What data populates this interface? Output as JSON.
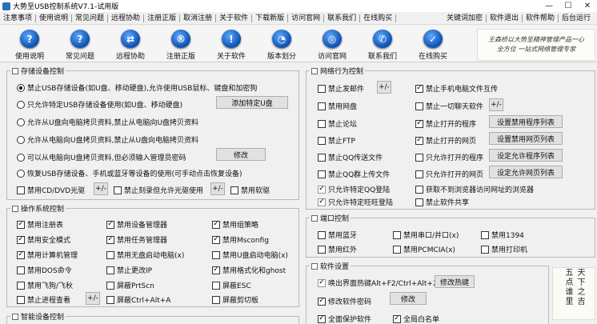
{
  "window": {
    "title": "大势至USB控制系统V7.1-试用版",
    "minimize": "—",
    "maximize": "☐",
    "close": "✕"
  },
  "menu": {
    "left": [
      "注意事项",
      "使用说明",
      "常见问题",
      "远程协助",
      "注册正版",
      "取消注册",
      "关于软件",
      "下载新版",
      "访问官网",
      "联系我们",
      "在线购买"
    ],
    "right": [
      "关键词加密",
      "软件退出",
      "软件帮助",
      "后台运行"
    ]
  },
  "toolbar": [
    {
      "label": "使用说明",
      "icon": "question-icon",
      "glyph": "?"
    },
    {
      "label": "常见问题",
      "icon": "question-icon",
      "glyph": "?"
    },
    {
      "label": "远程协助",
      "icon": "remote-icon",
      "glyph": "⇄"
    },
    {
      "label": "注册正版",
      "icon": "register-icon",
      "glyph": "®"
    },
    {
      "label": "关于软件",
      "icon": "info-icon",
      "glyph": "!"
    },
    {
      "label": "版本划分",
      "icon": "pie-icon",
      "glyph": "◔"
    },
    {
      "label": "访问官网",
      "icon": "globe-icon",
      "glyph": "◎"
    },
    {
      "label": "联系我们",
      "icon": "contact-icon",
      "glyph": "✆"
    },
    {
      "label": "在线购买",
      "icon": "cart-icon",
      "glyph": "✓"
    }
  ],
  "banner": {
    "line1": "王森桥以大势至精神管理产品一心",
    "line2": "全方位 一站式网络管理专家"
  },
  "side_banner": "天下之吉 五点谁里",
  "storage": {
    "title": "存储设备控制",
    "options": [
      {
        "label": "禁止USB存储设备(如U盘、移动硬盘),允许使用USB鼠标、键盘和加密狗",
        "selected": true
      },
      {
        "label": "只允许特定USB存储设备使用(如U盘、移动硬盘)",
        "selected": false
      },
      {
        "label": "允许从U盘向电脑拷贝资料,禁止从电脑向U盘拷贝资料",
        "selected": false
      },
      {
        "label": "允许从电脑向U盘拷贝资料,禁止从U盘向电脑拷贝资料",
        "selected": false
      },
      {
        "label": "可以从电脑向U盘拷贝资料,但必须输入管理员密码",
        "selected": false
      },
      {
        "label": "恢复USB存储设备、手机或蓝牙等设备的使用(可手动点击恢复设备)",
        "selected": false
      }
    ],
    "add_udisk": "添加特定U盘",
    "modify": "修改",
    "cd": "禁用CD/DVD光驱",
    "burn": "禁止刻录但允许光驱使用",
    "floppy": "禁用软驱",
    "plusminus": "+/-"
  },
  "os": {
    "title": "操作系统控制",
    "items": [
      {
        "label": "禁用注册表",
        "checked": true
      },
      {
        "label": "禁用设备管理器",
        "checked": true
      },
      {
        "label": "禁用组策略",
        "checked": true
      },
      {
        "label": "禁用安全模式",
        "checked": true
      },
      {
        "label": "禁用任务管理器",
        "checked": true
      },
      {
        "label": "禁用Msconfig",
        "checked": true
      },
      {
        "label": "禁用计算机管理",
        "checked": true
      },
      {
        "label": "禁用无盘启动电脑(x)",
        "checked": false
      },
      {
        "label": "禁用U盘启动电脑(x)",
        "checked": false
      },
      {
        "label": "禁用DOS命令",
        "checked": false
      },
      {
        "label": "禁止更改IP",
        "checked": false
      },
      {
        "label": "禁用格式化和ghost",
        "checked": true
      },
      {
        "label": "禁用飞狗/飞秋",
        "checked": false
      },
      {
        "label": "屏蔽PrtScn",
        "checked": false
      },
      {
        "label": "屏蔽ESC",
        "checked": false
      },
      {
        "label": "禁止进程查看",
        "checked": false
      },
      {
        "label": "屏蔽Ctrl+Alt+A",
        "checked": false
      },
      {
        "label": "屏蔽剪切板",
        "checked": false
      }
    ],
    "plusminus": "+/-"
  },
  "smart_title": "智能设备控制",
  "network": {
    "title": "网络行为控制",
    "left": [
      {
        "label": "禁止发邮件",
        "checked": false,
        "disabled": false
      },
      {
        "label": "禁用网盘",
        "checked": false,
        "disabled": false
      },
      {
        "label": "禁止论坛",
        "checked": false,
        "disabled": false
      },
      {
        "label": "禁止FTP",
        "checked": false,
        "disabled": false
      },
      {
        "label": "禁止QQ传送文件",
        "checked": false,
        "disabled": false
      },
      {
        "label": "禁止QQ群上传文件",
        "checked": false,
        "disabled": false
      },
      {
        "label": "只允许特定QQ登陆",
        "checked": true,
        "disabled": true
      },
      {
        "label": "只允许特定旺旺登陆",
        "checked": true,
        "disabled": true
      }
    ],
    "right": [
      {
        "label": "禁止手机电脑文件互传",
        "checked": true,
        "disabled": false
      },
      {
        "label": "禁止一切聊天软件",
        "checked": false,
        "disabled": false
      },
      {
        "label": "禁止打开的程序",
        "checked": true,
        "disabled": false
      },
      {
        "label": "禁止打开的网页",
        "checked": true,
        "disabled": false
      },
      {
        "label": "只允许打开的程序",
        "checked": false,
        "disabled": false
      },
      {
        "label": "只允许打开的网页",
        "checked": false,
        "disabled": false
      },
      {
        "label": "获取不到浏览器访问网址的浏览器",
        "checked": false,
        "disabled": false
      },
      {
        "label": "禁止软件共享",
        "checked": false,
        "disabled": false
      }
    ],
    "btn_set_prog": "设置禁用程序列表",
    "btn_set_web": "设置禁用网页列表",
    "btn_allow_prog": "设定允许程序列表",
    "btn_allow_web": "设定允许网页列表",
    "plusminus": "+/-"
  },
  "port": {
    "title": "端口控制",
    "items": [
      {
        "label": "禁用蓝牙",
        "checked": false
      },
      {
        "label": "禁用串口/并口(x)",
        "checked": false
      },
      {
        "label": "禁用1394",
        "checked": false
      },
      {
        "label": "禁用红外",
        "checked": false
      },
      {
        "label": "禁用PCMCIA(x)",
        "checked": false
      },
      {
        "label": "禁用打印机",
        "checked": false
      }
    ]
  },
  "settings": {
    "title": "软件设置",
    "hotkey": "唤出界面热键Alt+F2/Ctrl+Alt+2",
    "hotkey_btn": "修改热键",
    "password": "修改软件密码",
    "password_btn": "修改",
    "protect": "全面保护软件",
    "whitelist": "全局白名单"
  }
}
